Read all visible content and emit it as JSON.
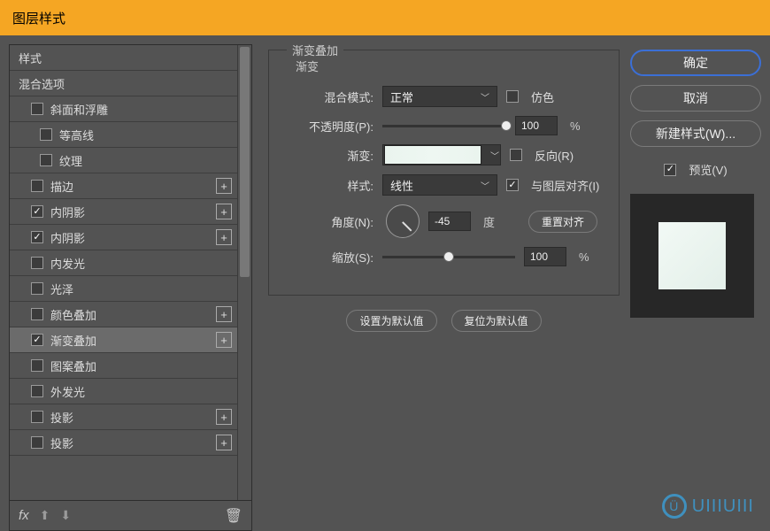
{
  "window": {
    "title": "图层样式"
  },
  "sidebar": {
    "header": "样式",
    "blend_options": "混合选项",
    "items": [
      {
        "label": "斜面和浮雕",
        "checked": false,
        "plus": false,
        "indent": 1
      },
      {
        "label": "等高线",
        "checked": false,
        "plus": false,
        "indent": 2
      },
      {
        "label": "纹理",
        "checked": false,
        "plus": false,
        "indent": 2
      },
      {
        "label": "描边",
        "checked": false,
        "plus": true,
        "indent": 1
      },
      {
        "label": "内阴影",
        "checked": true,
        "plus": true,
        "indent": 1
      },
      {
        "label": "内阴影",
        "checked": true,
        "plus": true,
        "indent": 1
      },
      {
        "label": "内发光",
        "checked": false,
        "plus": false,
        "indent": 1
      },
      {
        "label": "光泽",
        "checked": false,
        "plus": false,
        "indent": 1
      },
      {
        "label": "颜色叠加",
        "checked": false,
        "plus": true,
        "indent": 1
      },
      {
        "label": "渐变叠加",
        "checked": true,
        "plus": true,
        "indent": 1,
        "selected": true
      },
      {
        "label": "图案叠加",
        "checked": false,
        "plus": false,
        "indent": 1
      },
      {
        "label": "外发光",
        "checked": false,
        "plus": false,
        "indent": 1
      },
      {
        "label": "投影",
        "checked": false,
        "plus": true,
        "indent": 1
      },
      {
        "label": "投影",
        "checked": false,
        "plus": true,
        "indent": 1
      }
    ],
    "footer": {
      "fx": "fx"
    }
  },
  "panel": {
    "group_title": "渐变叠加",
    "sub_title": "渐变",
    "blend_mode_label": "混合模式:",
    "blend_mode_value": "正常",
    "dither_label": "仿色",
    "opacity_label": "不透明度(P):",
    "opacity_value": "100",
    "opacity_unit": "%",
    "gradient_label": "渐变:",
    "reverse_label": "反向(R)",
    "style_label": "样式:",
    "style_value": "线性",
    "align_label": "与图层对齐(I)",
    "align_checked": true,
    "angle_label": "角度(N):",
    "angle_value": "-45",
    "angle_unit": "度",
    "reset_align": "重置对齐",
    "scale_label": "缩放(S):",
    "scale_value": "100",
    "scale_unit": "%",
    "set_default": "设置为默认值",
    "reset_default": "复位为默认值"
  },
  "right": {
    "ok": "确定",
    "cancel": "取消",
    "new_style": "新建样式(W)...",
    "preview_label": "预览(V)"
  },
  "watermark": "UIIIUIII"
}
